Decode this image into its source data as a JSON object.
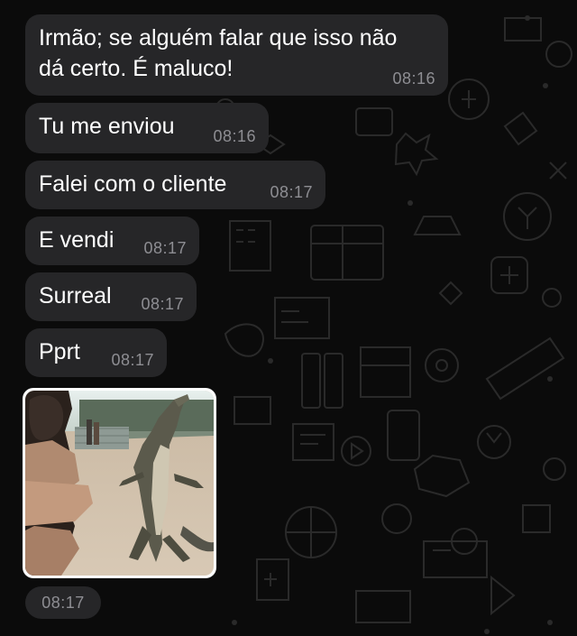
{
  "chat": {
    "messages": [
      {
        "text": "Irmão; se alguém falar que isso não\ndá certo. É maluco!",
        "time": "08:16"
      },
      {
        "text": "Tu me enviou",
        "time": "08:16"
      },
      {
        "text": "Falei com o cliente",
        "time": "08:17"
      },
      {
        "text": "E vendi",
        "time": "08:17"
      },
      {
        "text": "Surreal",
        "time": "08:17"
      },
      {
        "text": "Pprt",
        "time": "08:17"
      }
    ],
    "media": {
      "kind": "video-thumbnail",
      "time": "08:17"
    }
  },
  "icons": {
    "wallpaper": "doodle-pattern-icons"
  },
  "colors": {
    "background": "#0b0b0b",
    "bubble": "#262628",
    "text": "#ffffff",
    "timestamp": "#8e8e93",
    "media_border": "#ffffff"
  }
}
